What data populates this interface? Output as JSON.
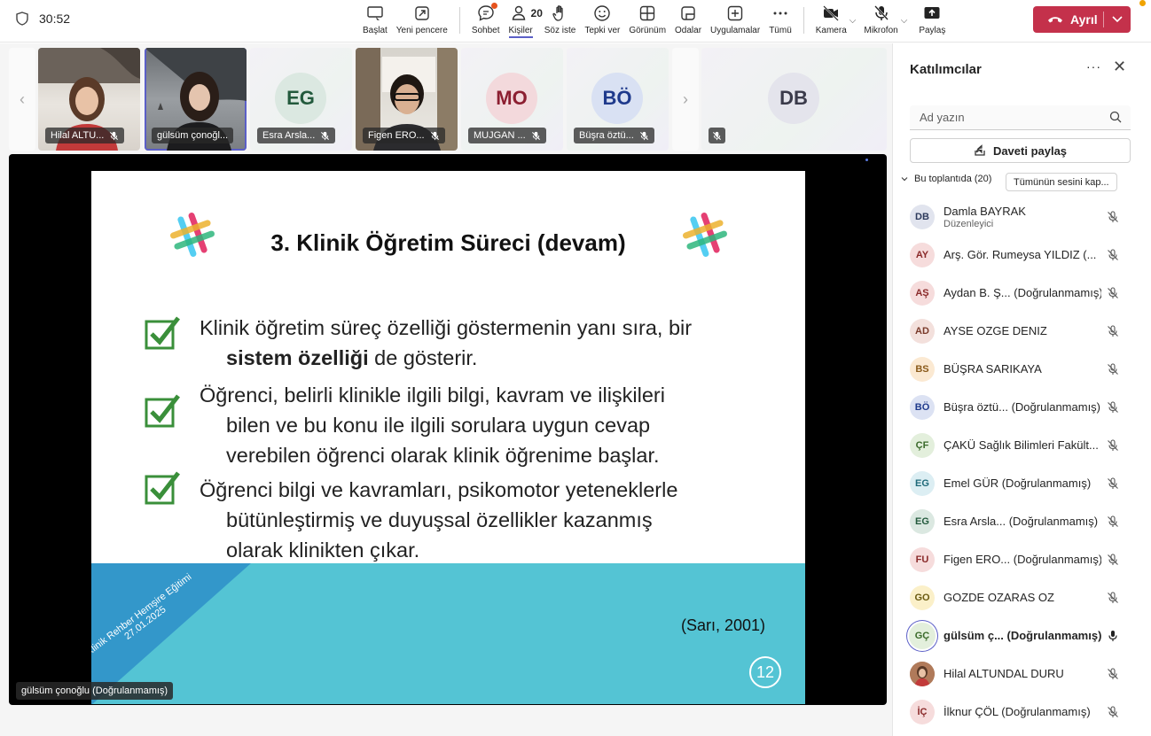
{
  "meeting": {
    "timer": "30:52"
  },
  "toolbar": {
    "items": [
      {
        "label": "Başlat",
        "icon": "screen-record-icon"
      },
      {
        "label": "Yeni pencere",
        "icon": "popout-icon"
      },
      {
        "label": "Sohbet",
        "icon": "chat-icon"
      },
      {
        "label": "Kişiler",
        "icon": "people-icon",
        "count": "20"
      },
      {
        "label": "Söz iste",
        "icon": "raise-hand-icon"
      },
      {
        "label": "Tepki ver",
        "icon": "smiley-icon"
      },
      {
        "label": "Görünüm",
        "icon": "grid-icon"
      },
      {
        "label": "Odalar",
        "icon": "rooms-icon"
      },
      {
        "label": "Uygulamalar",
        "icon": "add-app-icon"
      },
      {
        "label": "Tümü",
        "icon": "more-icon"
      }
    ],
    "camera_label": "Kamera",
    "mic_label": "Mikrofon",
    "share_label": "Paylaş",
    "leave_label": "Ayrıl",
    "colors": {
      "leave": "#c4314b",
      "accent": "#5b5fc7"
    }
  },
  "strip": {
    "tiles": [
      {
        "name": "Hilal ALTU...",
        "type": "video"
      },
      {
        "name": "gülsüm çonoğl...",
        "type": "video",
        "selected": true
      },
      {
        "name": "Esra Arsla...",
        "type": "avatar",
        "initials": "EG",
        "color": "#dbe8e1",
        "fg": "#235a3d"
      },
      {
        "name": "Figen ERO...",
        "type": "video"
      },
      {
        "name": "MUJGAN ...",
        "type": "avatar",
        "initials": "MO",
        "color": "#f3d9dc",
        "fg": "#8c1f31"
      },
      {
        "name": "Büşra öztü...",
        "type": "avatar",
        "initials": "BÖ",
        "color": "#d9e1f3",
        "fg": "#1f3a8c"
      },
      {
        "name": "",
        "type": "avatar",
        "initials": "DB",
        "color": "#e4e4ec",
        "fg": "#3a3a4a"
      }
    ]
  },
  "share": {
    "presenter": "gülsüm çonoğlu (Doğrulanmamış)",
    "slide": {
      "title": "3. Klinik Öğretim Süreci (devam)",
      "bullets": [
        {
          "line1": "Klinik öğretim süreç özelliği göstermenin yanı sıra, bir",
          "bold": "sistem özelliği",
          "rest": " de gösterir."
        },
        {
          "line1": "Öğrenci, belirli klinikle ilgili bilgi, kavram ve ilişkileri",
          "line2": "bilen ve bu konu ile ilgili sorulara uygun cevap",
          "line3": "verebilen öğrenci olarak klinik öğrenime başlar."
        },
        {
          "line1": "Öğrenci bilgi ve kavramları, psikomotor yeteneklerle",
          "line2": "bütünleştirmiş ve duyuşsal özellikler kazanmış",
          "line3": "olarak klinikten çıkar."
        }
      ],
      "diagonal_line1": "Klinik Rehber Hemşire Eğitimi",
      "diagonal_line2": "27.01.2025",
      "citation": "(Sarı, 2001)",
      "page": "12"
    }
  },
  "panel": {
    "title": "Katılımcılar",
    "search_placeholder": "Ad yazın",
    "invite_label": "Daveti paylaş",
    "section_label": "Bu toplantıda (20)",
    "mute_all_label": "Tümünün sesini kap...",
    "participants": [
      {
        "initials": "DB",
        "name": "Damla BAYRAK",
        "role": "Düzenleyici",
        "bg": "#e1e4ee",
        "fg": "#2d3a5c",
        "mic": "off"
      },
      {
        "initials": "AY",
        "name": "Arş. Gör. Rumeysa YILDIZ (...",
        "bg": "#f6dcdc",
        "fg": "#8a2a2a",
        "mic": "off"
      },
      {
        "initials": "AŞ",
        "name": "Aydan B. Ş... (Doğrulanmamış)",
        "bg": "#f6dcdc",
        "fg": "#8a2a2a",
        "mic": "off"
      },
      {
        "initials": "AD",
        "name": "AYSE OZGE DENIZ",
        "bg": "#f3e0dc",
        "fg": "#7a3a2a",
        "mic": "off"
      },
      {
        "initials": "BS",
        "name": "BÜŞRA SARIKAYA",
        "bg": "#fbe9d2",
        "fg": "#8a5a1a",
        "mic": "off"
      },
      {
        "initials": "BÖ",
        "name": "Büşra öztü... (Doğrulanmamış)",
        "bg": "#dce2f3",
        "fg": "#1f3a8c",
        "mic": "off"
      },
      {
        "initials": "ÇF",
        "name": "ÇAKÜ Sağlık Bilimleri Fakült...",
        "bg": "#e3efdc",
        "fg": "#3a6a2a",
        "mic": "off"
      },
      {
        "initials": "EG",
        "name": "Emel GÜR (Doğrulanmamış)",
        "bg": "#dceef3",
        "fg": "#1f6a7a",
        "mic": "off"
      },
      {
        "initials": "EG",
        "name": "Esra Arsla... (Doğrulanmamış)",
        "bg": "#dbe8e1",
        "fg": "#235a3d",
        "mic": "off"
      },
      {
        "initials": "FU",
        "name": "Figen ERO... (Doğrulanmamış)",
        "bg": "#f6dcdc",
        "fg": "#8a2a2a",
        "mic": "off"
      },
      {
        "initials": "GO",
        "name": "GOZDE OZARAS OZ",
        "bg": "#fbf0c9",
        "fg": "#6a5a10",
        "mic": "off"
      },
      {
        "initials": "GÇ",
        "name": "gülsüm ç... (Doğrulanmamış)",
        "bg": "#e3efdc",
        "fg": "#3a6a2a",
        "mic": "on",
        "speaking": true
      },
      {
        "initials": "",
        "name": "Hilal ALTUNDAL DURU",
        "bg": "#b07a5a",
        "fg": "#fff",
        "mic": "off",
        "photo": true
      },
      {
        "initials": "İÇ",
        "name": "İlknur ÇÖL (Doğrulanmamış)",
        "bg": "#f6dcdc",
        "fg": "#8a2a2a",
        "mic": "off"
      }
    ]
  }
}
